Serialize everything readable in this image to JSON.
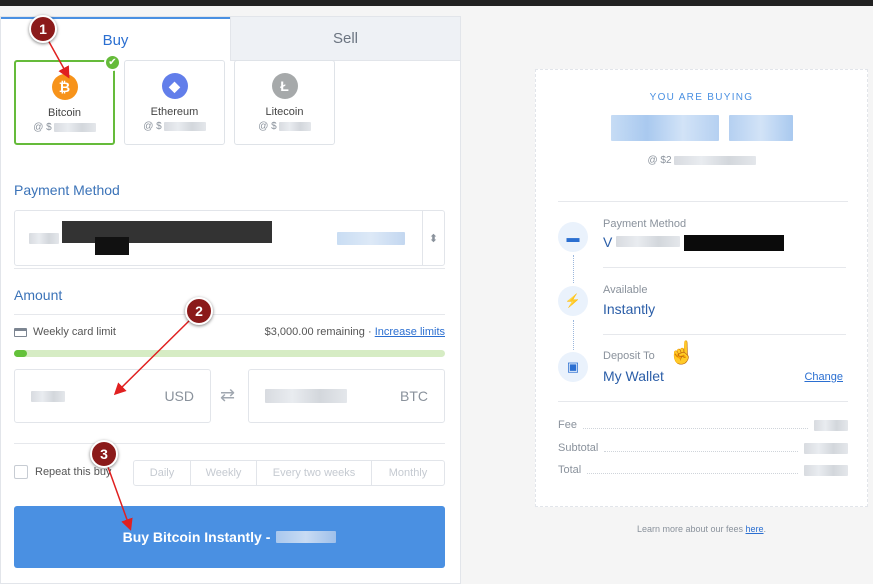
{
  "tabs": [
    {
      "label": "Buy"
    },
    {
      "label": "Sell"
    }
  ],
  "coins": [
    {
      "name": "Bitcoin",
      "price_prefix": "@ $",
      "icon": "bitcoin-icon",
      "color": "#f7931a",
      "glyph": "₿",
      "selected": true
    },
    {
      "name": "Ethereum",
      "price_prefix": "@ $",
      "icon": "ethereum-icon",
      "color": "#627eea",
      "glyph": "◆",
      "selected": false
    },
    {
      "name": "Litecoin",
      "price_prefix": "@ $",
      "icon": "litecoin-icon",
      "color": "#a6a9aa",
      "glyph": "Ł",
      "selected": false
    }
  ],
  "payment_method": {
    "title": "Payment Method"
  },
  "amount": {
    "title": "Amount",
    "limit_label": "Weekly card limit",
    "remaining": "$3,000.00 remaining",
    "separator": " · ",
    "increase_link": "Increase limits",
    "progress": 0.03,
    "fiat_unit": "USD",
    "crypto_unit": "BTC"
  },
  "repeat": {
    "label": "Repeat this buy",
    "options": [
      "Daily",
      "Weekly",
      "Every two weeks",
      "Monthly"
    ]
  },
  "buy_button": {
    "label": "Buy Bitcoin Instantly -"
  },
  "summary": {
    "heading": "YOU ARE BUYING",
    "price_prefix": "@ $2",
    "payment_label": "Payment Method",
    "payment_value_prefix": "V",
    "available_label": "Available",
    "available_value": "Instantly",
    "deposit_label": "Deposit To",
    "deposit_value": "My Wallet",
    "change_link": "Change",
    "fee_label": "Fee",
    "subtotal_label": "Subtotal",
    "total_label": "Total"
  },
  "footer": {
    "text": "Learn more about our fees ",
    "link": "here",
    "suffix": "."
  },
  "annotations": [
    "1",
    "2",
    "3"
  ],
  "colors": {
    "accent": "#4a90e2",
    "success": "#65bb3a",
    "marker": "#8b1a1a"
  }
}
